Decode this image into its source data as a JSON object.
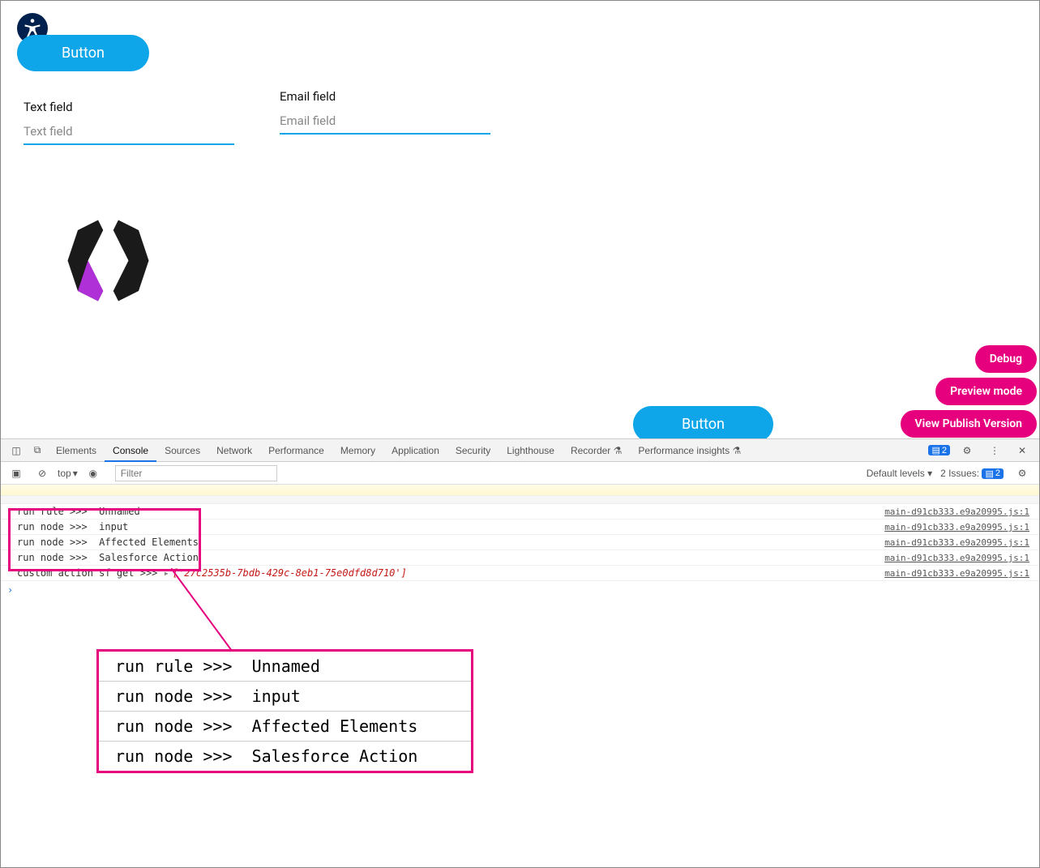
{
  "buttons": {
    "top": "Button",
    "bottom": "Button"
  },
  "fields": {
    "text": {
      "label": "Text field",
      "placeholder": "Text field"
    },
    "email": {
      "label": "Email field",
      "placeholder": "Email field"
    }
  },
  "pink": {
    "debug": "Debug",
    "preview": "Preview mode",
    "publish": "View Publish Version"
  },
  "devtools": {
    "tabs": [
      "Elements",
      "Console",
      "Sources",
      "Network",
      "Performance",
      "Memory",
      "Application",
      "Security",
      "Lighthouse",
      "Recorder ⚗",
      "Performance insights ⚗"
    ],
    "active_tab": "Console",
    "badge_count": "2",
    "filter_placeholder": "Filter",
    "context": "top",
    "levels": "Default levels",
    "issues_label": "2 Issues:",
    "issues_count": "2",
    "source": "main-d91cb333.e9a20995.js:1",
    "rows": [
      "run rule >>>  Unnamed",
      "run node >>>  input",
      "run node >>>  Affected Elements",
      "run node >>>  Salesforce Action"
    ],
    "custom_prefix": "custom action sf get >>> ",
    "custom_array": "['27c2535b-7bdb-429c-8eb1-75e0dfd8d710']"
  },
  "zoom_rows": [
    "run rule >>>  Unnamed",
    "run node >>>  input",
    "run node >>>  Affected Elements",
    "run node >>>  Salesforce Action"
  ]
}
